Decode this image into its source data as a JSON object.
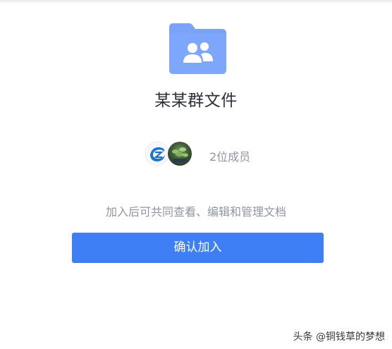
{
  "folder": {
    "icon": "group-folder-icon",
    "name": "某某群文件",
    "color": "#7aa2f7"
  },
  "members": {
    "avatars": [
      "avatar-icon-blue-logo",
      "avatar-icon-plant"
    ],
    "count_label": "2位成员"
  },
  "hint": "加入后可共同查看、编辑和管理文档",
  "join_button": {
    "label": "确认加入",
    "color": "#3f7ff6"
  },
  "watermark": "头条 @铜钱草的梦想"
}
